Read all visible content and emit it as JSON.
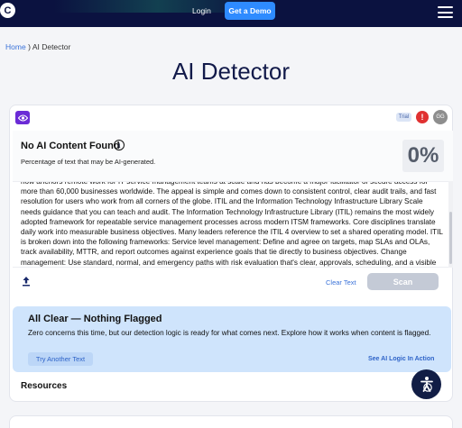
{
  "nav": {
    "logo_letter": "C",
    "login": "Login",
    "get_demo": "Get a Demo",
    "icons": [
      "logo",
      "hamburger-menu-icon"
    ]
  },
  "breadcrumb": {
    "home": "Home",
    "separator": ")",
    "current": "AI Detector"
  },
  "page_title": "AI Detector",
  "toolbar": {
    "trial_badge": "Trial",
    "alert_symbol": "!",
    "avatar_initials": "GG"
  },
  "result": {
    "title": "No AI Content Found",
    "subtitle": "Percentage of text that may be AI-generated.",
    "score": "0%"
  },
  "input_text": "how anchors remote work for IT service management teams at scale and has become a major facilitator of secure access for more than 60,000 businesses worldwide. The appeal is simple and comes down to consistent control, clear audit trails, and fast resolution for users who work from all corners of the globe. ITIL and the Information Technology Infrastructure Library Scale needs guidance that you can teach and audit. The Information Technology Infrastructure Library (ITIL) remains the most widely adopted framework for repeatable service management processes across modern ITSM frameworks. Core disciplines translate daily work into measurable business objectives. Many leaders reference the ITIL 4 overview to set a shared operating model. ITIL is broken down into the following frameworks: Service level management: Define and agree on targets, map SLAs and OLAs, track availability, MTTR, and report outcomes against experience goals that tie directly to business objectives. Change management: Use standard, normal, and emergency paths with risk evaluation that's clear, approvals, scheduling, and a visible",
  "actions": {
    "clear_text": "Clear Text",
    "scan": "Scan"
  },
  "all_clear": {
    "title": "All Clear — Nothing Flagged",
    "description": "Zero concerns this time, but our detection logic is ready for what comes next. Explore how it works when content is flagged.",
    "try_another": "Try Another Text",
    "see_logic": "See AI Logic In Action"
  },
  "resources_heading": "Resources",
  "colors": {
    "nav_bg": "#0b1240",
    "accent": "#2e8bff",
    "eye_button": "#6b2bd6",
    "alert": "#e03131",
    "clear_panel": "#cfe4fc",
    "link": "#3b73d9"
  }
}
